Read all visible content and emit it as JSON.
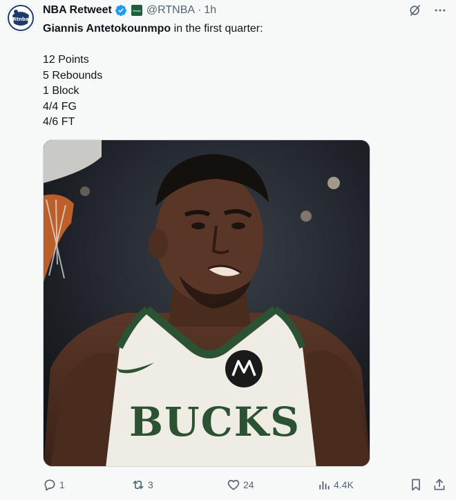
{
  "author": {
    "display_name": "NBA Retweet",
    "avatar_text": "Rtnba",
    "affiliate_label": "Kanta",
    "handle": "@RTNBA",
    "separator": "·",
    "time": "1h"
  },
  "tweet": {
    "mention": "Giannis Antetokounmpo",
    "intro_rest": " in the first quarter:",
    "stats": [
      "12 Points",
      "5 Rebounds",
      "1 Block",
      "4/4 FG",
      "4/6 FT"
    ],
    "media": {
      "alt": "Giannis Antetokounmpo in Milwaukee Bucks jersey",
      "jersey_text": "BUCKS"
    }
  },
  "actions": {
    "replies": "1",
    "retweets": "3",
    "likes": "24",
    "views": "4.4K"
  },
  "colors": {
    "background": "#f7f9f9",
    "text": "#0f1419",
    "secondary": "#536471",
    "verified": "#1d9bf0",
    "bucks_green": "#2c5234",
    "jersey_cream": "#eeece3"
  },
  "icons": {
    "verified": "verified-badge-icon",
    "grok": "grok-icon",
    "more": "more-icon",
    "reply": "reply-icon",
    "retweet": "retweet-icon",
    "like": "heart-icon",
    "views": "views-icon",
    "bookmark": "bookmark-icon",
    "share": "share-icon"
  }
}
